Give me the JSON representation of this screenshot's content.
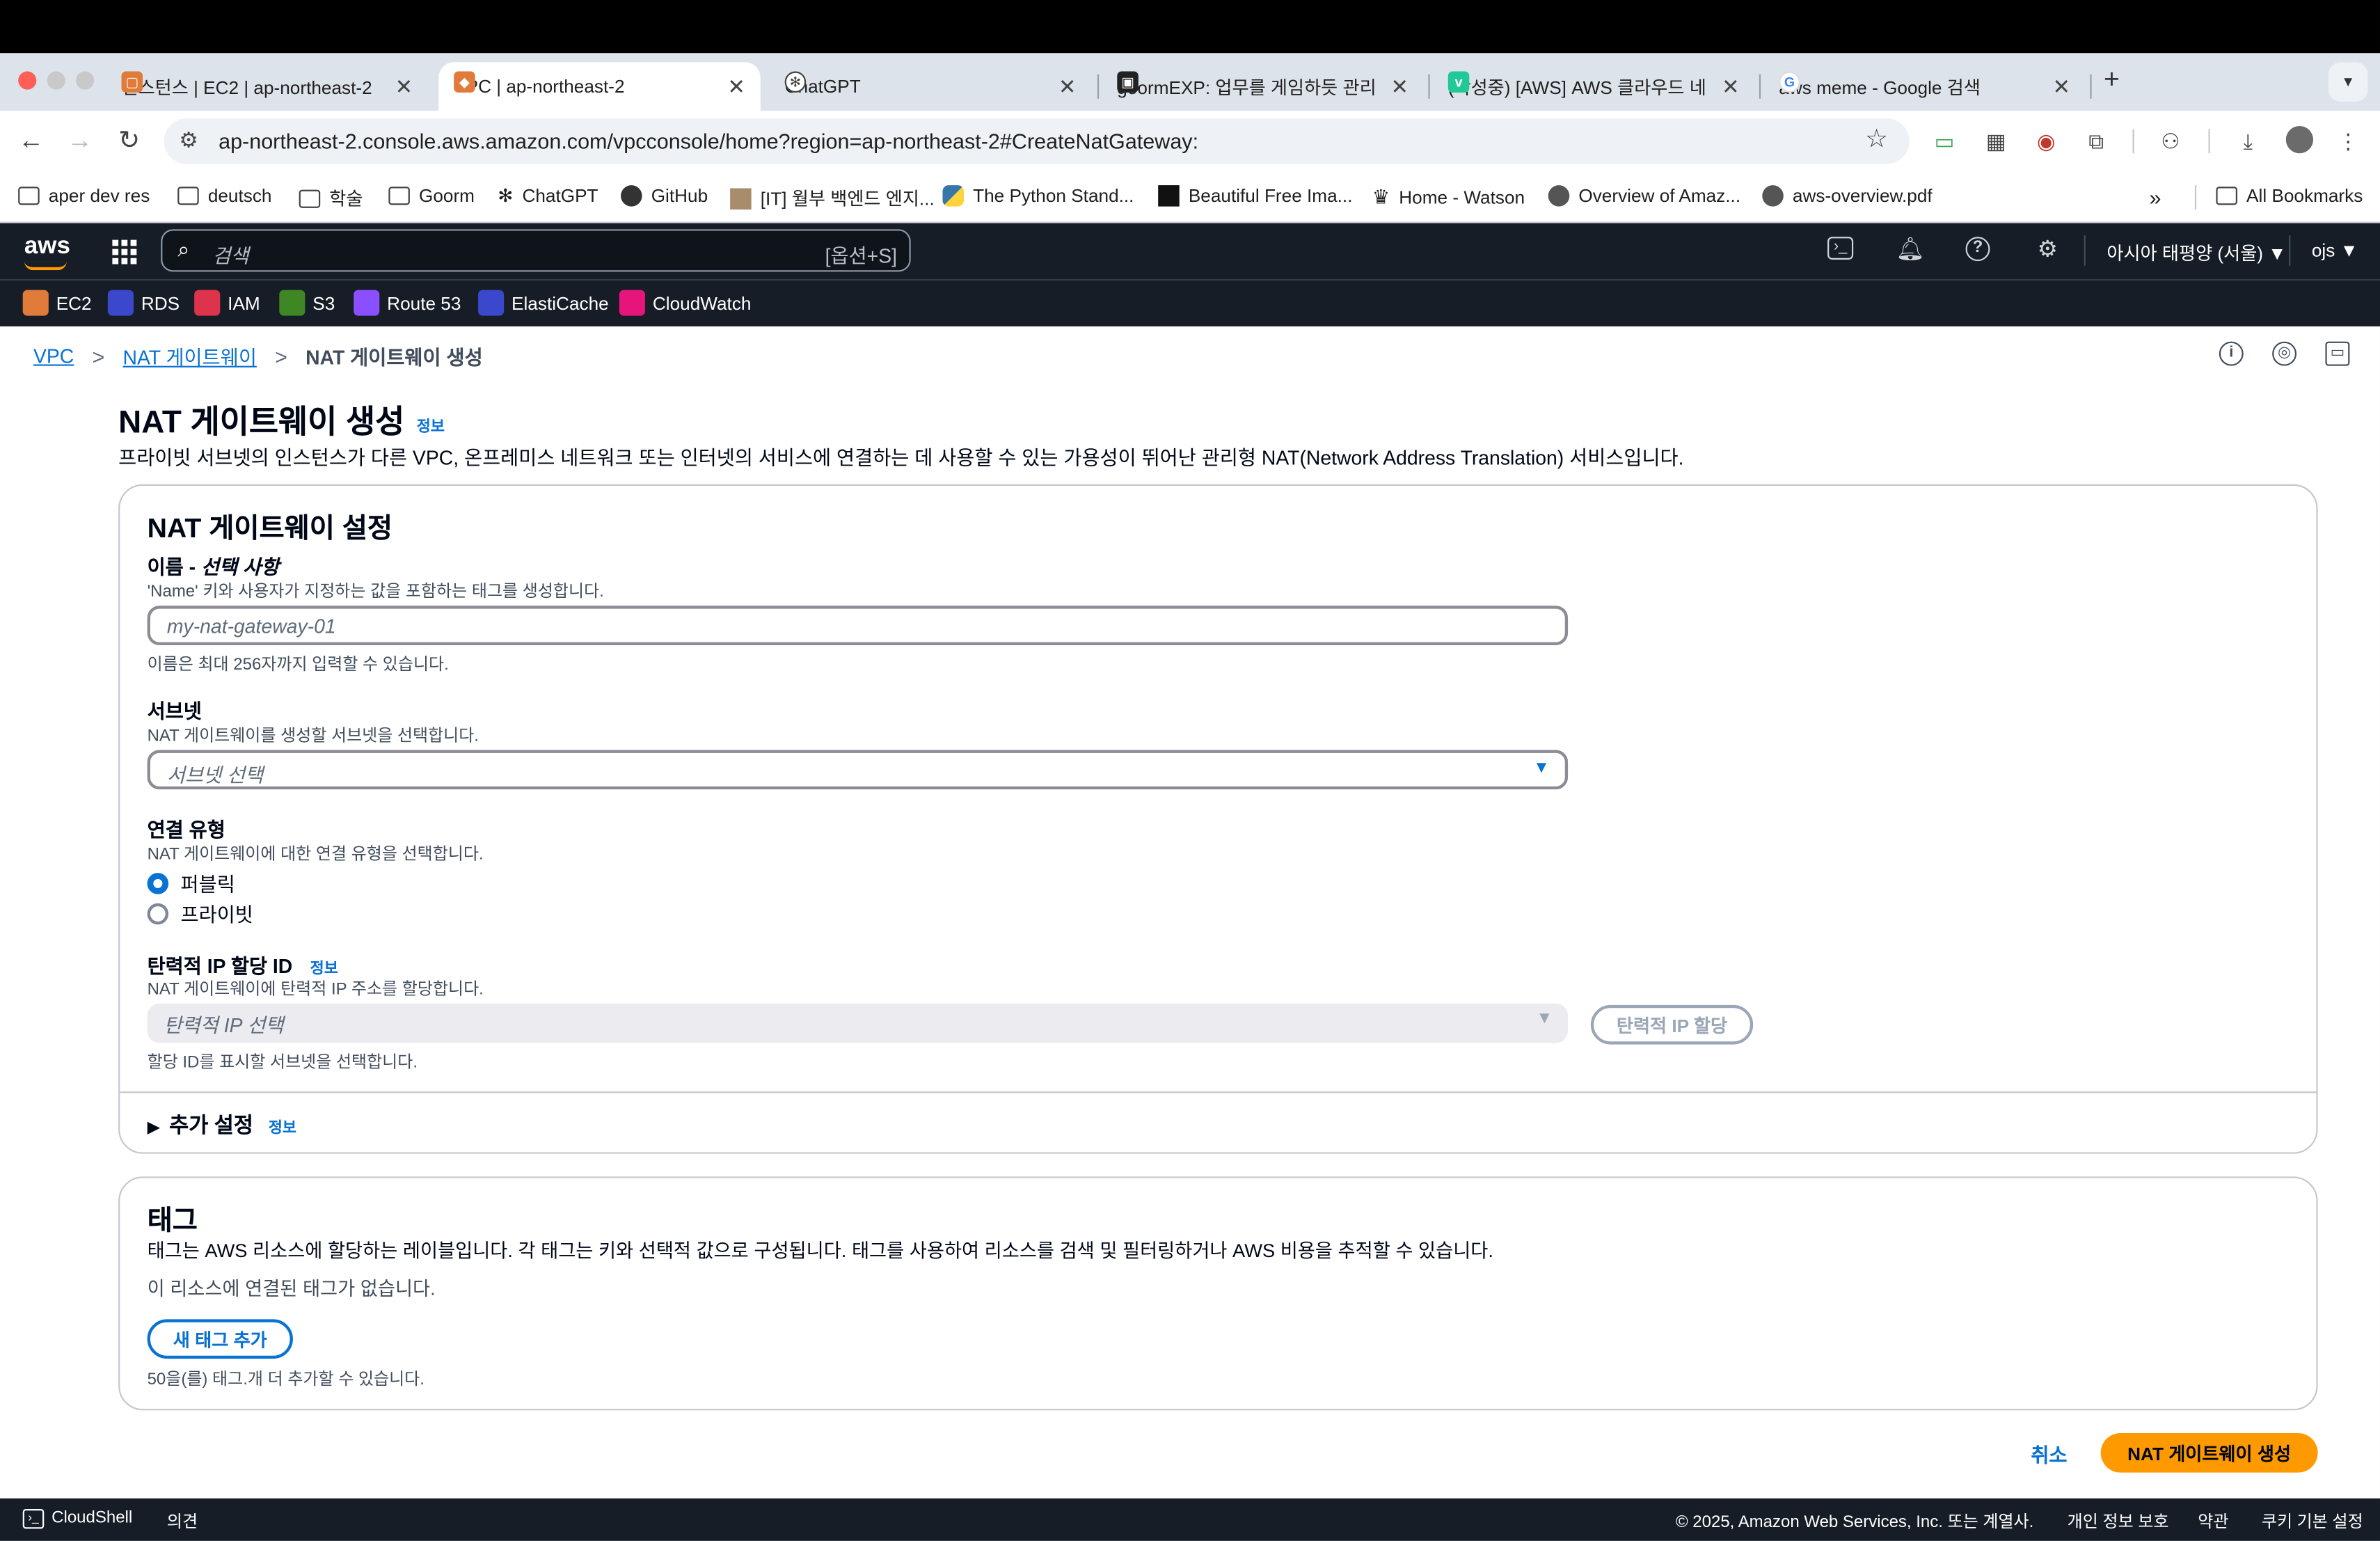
{
  "browser": {
    "tabs": [
      {
        "title": "인스턴스 | EC2 | ap-northeast-2",
        "favicon_color": "#e07b39"
      },
      {
        "title": "VPC | ap-northeast-2",
        "favicon_color": "#e07b39"
      },
      {
        "title": "ChatGPT",
        "favicon_color": "#444444"
      },
      {
        "title": "goormEXP: 업무를 게임하듯 관리",
        "favicon_color": "#222222"
      },
      {
        "title": "(작성중) [AWS] AWS 클라우드 네",
        "favicon_color": "#20c997"
      },
      {
        "title": "aws meme - Google 검색",
        "favicon_color": "#4285f4"
      }
    ],
    "new_tab": "+",
    "url": "ap-northeast-2.console.aws.amazon.com/vpcconsole/home?region=ap-northeast-2#CreateNatGateway:",
    "bookmarks": [
      {
        "label": "aper dev res",
        "icon": "folder-icon"
      },
      {
        "label": "deutsch",
        "icon": "folder-icon"
      },
      {
        "label": "학술",
        "icon": "folder-icon"
      },
      {
        "label": "Goorm",
        "icon": "folder-icon"
      },
      {
        "label": "ChatGPT",
        "icon": "chatgpt-icon"
      },
      {
        "label": "GitHub",
        "icon": "github-icon"
      },
      {
        "label": "[IT] 월부 백엔드 엔지...",
        "icon": "page-icon"
      },
      {
        "label": "The Python Stand...",
        "icon": "python-icon"
      },
      {
        "label": "Beautiful Free Ima...",
        "icon": "unsplash-icon"
      },
      {
        "label": "Home - Watson",
        "icon": "watson-icon"
      },
      {
        "label": "Overview of Amaz...",
        "icon": "globe-icon"
      },
      {
        "label": "aws-overview.pdf",
        "icon": "globe-icon"
      }
    ],
    "bookmarks_more": "»",
    "all_bookmarks": "All Bookmarks"
  },
  "aws_nav": {
    "logo": "aws",
    "search_placeholder": "검색",
    "search_shortcut": "[옵션+S]",
    "region": "아시아 태평양 (서울) ▼",
    "user": "ojs ▼",
    "favorites": [
      {
        "label": "EC2",
        "color": "#e07b39"
      },
      {
        "label": "RDS",
        "color": "#3b48cc"
      },
      {
        "label": "IAM",
        "color": "#dd344c"
      },
      {
        "label": "S3",
        "color": "#3f8624"
      },
      {
        "label": "Route 53",
        "color": "#8c4fff"
      },
      {
        "label": "ElastiCache",
        "color": "#3b48cc"
      },
      {
        "label": "CloudWatch",
        "color": "#e7157b"
      }
    ]
  },
  "breadcrumb": {
    "items": [
      "VPC",
      "NAT 게이트웨이"
    ],
    "current": "NAT 게이트웨이 생성",
    "separator": ">"
  },
  "page": {
    "title": "NAT 게이트웨이 생성",
    "info": "정보",
    "description": "프라이빗 서브넷의 인스턴스가 다른 VPC, 온프레미스 네트워크 또는 인터넷의 서비스에 연결하는 데 사용할 수 있는 가용성이 뛰어난 관리형 NAT(Network Address Translation) 서비스입니다."
  },
  "settings": {
    "heading": "NAT 게이트웨이 설정",
    "name_label": "이름 - ",
    "name_label_optional": "선택 사항",
    "name_desc": "'Name' 키와 사용자가 지정하는 값을 포함하는 태그를 생성합니다.",
    "name_placeholder": "my-nat-gateway-01",
    "name_constraint": "이름은 최대 256자까지 입력할 수 있습니다.",
    "subnet_label": "서브넷",
    "subnet_desc": "NAT 게이트웨이를 생성할 서브넷을 선택합니다.",
    "subnet_placeholder": "서브넷 선택",
    "conn_label": "연결 유형",
    "conn_desc": "NAT 게이트웨이에 대한 연결 유형을 선택합니다.",
    "conn_options": [
      "퍼블릭",
      "프라이빗"
    ],
    "conn_selected": "퍼블릭",
    "eip_label": "탄력적 IP 할당 ID",
    "eip_info": "정보",
    "eip_desc": "NAT 게이트웨이에 탄력적 IP 주소를 할당합니다.",
    "eip_placeholder": "탄력적 IP 선택",
    "eip_button": "탄력적 IP 할당",
    "eip_constraint": "할당 ID를 표시할 서브넷을 선택합니다.",
    "additional": "추가 설정",
    "additional_info": "정보"
  },
  "tags": {
    "heading": "태그",
    "desc": "태그는 AWS 리소스에 할당하는 레이블입니다. 각 태그는 키와 선택적 값으로 구성됩니다. 태그를 사용하여 리소스를 검색 및 필터링하거나 AWS 비용을 추적할 수 있습니다.",
    "empty": "이 리소스에 연결된 태그가 없습니다.",
    "add_button": "새 태그 추가",
    "limit": "50을(를) 태그.개 더 추가할 수 있습니다."
  },
  "actions": {
    "cancel": "취소",
    "submit": "NAT 게이트웨이 생성"
  },
  "footer": {
    "cloudshell": "CloudShell",
    "feedback": "의견",
    "copyright": "© 2025, Amazon Web Services, Inc. 또는 계열사.",
    "privacy": "개인 정보 보호",
    "terms": "약관",
    "cookies": "쿠키 기본 설정"
  },
  "colors": {
    "link": "#0972d3",
    "primary": "#ff9900",
    "console_nav": "#161d26"
  }
}
